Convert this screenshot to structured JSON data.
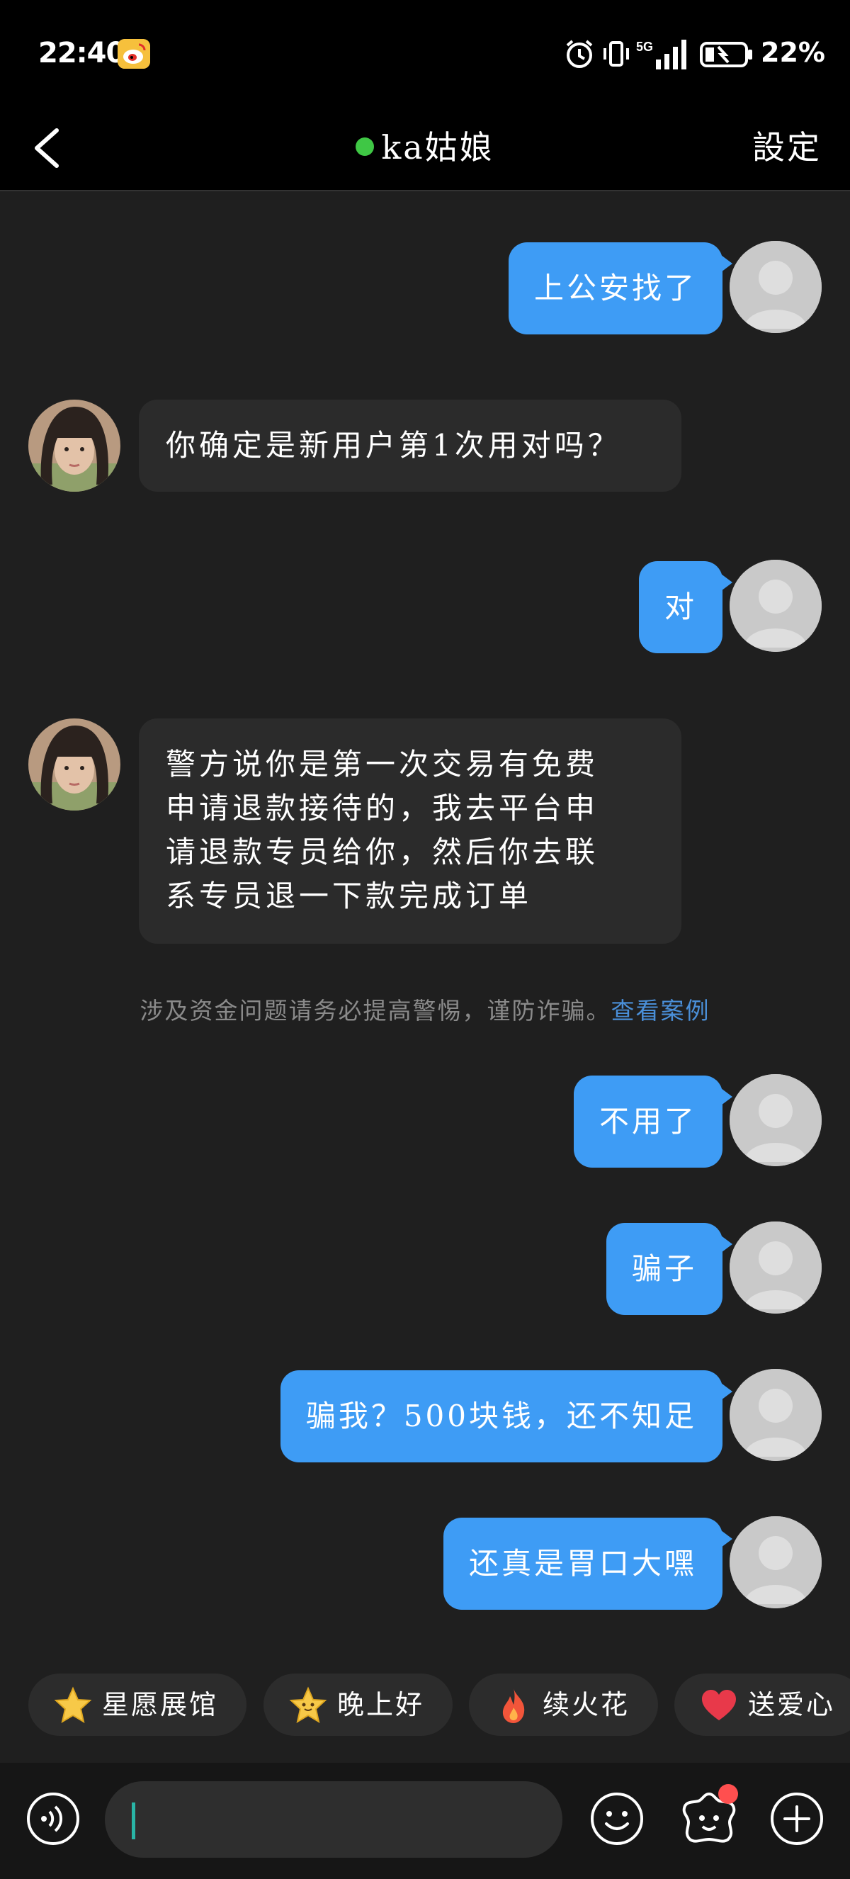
{
  "status_bar": {
    "time": "22:40",
    "network": "5G",
    "battery": "22%"
  },
  "header": {
    "title": "ka姑娘",
    "settings_label": "設定",
    "online_color": "#3fc745"
  },
  "messages": [
    {
      "side": "out",
      "text": "上公安找了"
    },
    {
      "side": "in",
      "text": "你确定是新用户第1次用对吗？"
    },
    {
      "side": "out",
      "text": "对"
    },
    {
      "side": "in",
      "lines": [
        "警方说你是第一次交易有免费",
        "申请退款接待的，我去平台申",
        "请退款专员给你，然后你去联",
        "系专员退一下款完成订单"
      ]
    },
    {
      "side": "out",
      "text": "不用了"
    },
    {
      "side": "out",
      "text": "骗子"
    },
    {
      "side": "out",
      "text": "骗我？500块钱，还不知足"
    },
    {
      "side": "out",
      "text": "还真是胃口大嘿"
    }
  ],
  "notice": {
    "text": "涉及资金问题请务必提高警惕，谨防诈骗。",
    "link": "查看案例"
  },
  "quick_chips": [
    {
      "label": "星愿展馆",
      "icon": "star-icon"
    },
    {
      "label": "晚上好",
      "icon": "star-face-icon"
    },
    {
      "label": "续火花",
      "icon": "fire-icon"
    },
    {
      "label": "送爱心",
      "icon": "heart-icon"
    }
  ],
  "input": {
    "placeholder": ""
  },
  "colors": {
    "outgoing_bubble": "#3e9cf5",
    "incoming_bubble": "#2b2b2b",
    "link": "#4a8fd8"
  }
}
